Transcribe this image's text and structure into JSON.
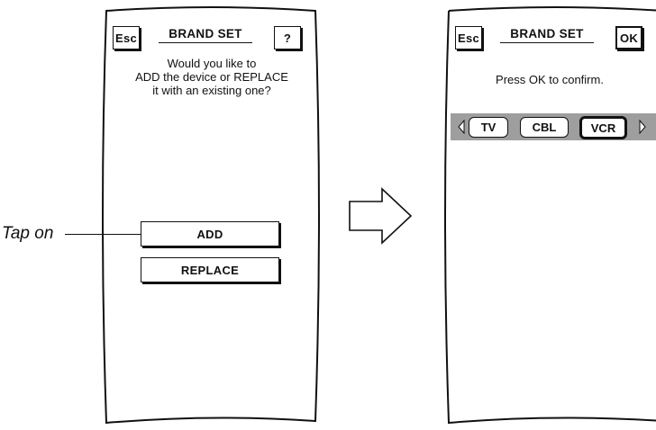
{
  "left_screen": {
    "esc_label": "Esc",
    "title": "BRAND SET",
    "help_label": "?",
    "message_lines": [
      "Would you like to",
      "ADD the device or REPLACE",
      "it with an existing one?"
    ],
    "add_label": "ADD",
    "replace_label": "REPLACE"
  },
  "callout": {
    "text": "Tap on"
  },
  "transition_arrow": "right-arrow-icon",
  "right_screen": {
    "esc_label": "Esc",
    "title": "BRAND SET",
    "ok_label": "OK",
    "message": "Press OK to confirm.",
    "tabs": [
      {
        "label": "TV",
        "selected": false
      },
      {
        "label": "CBL",
        "selected": false
      },
      {
        "label": "VCR",
        "selected": true
      }
    ],
    "bar_color": "#9e9e9e"
  }
}
